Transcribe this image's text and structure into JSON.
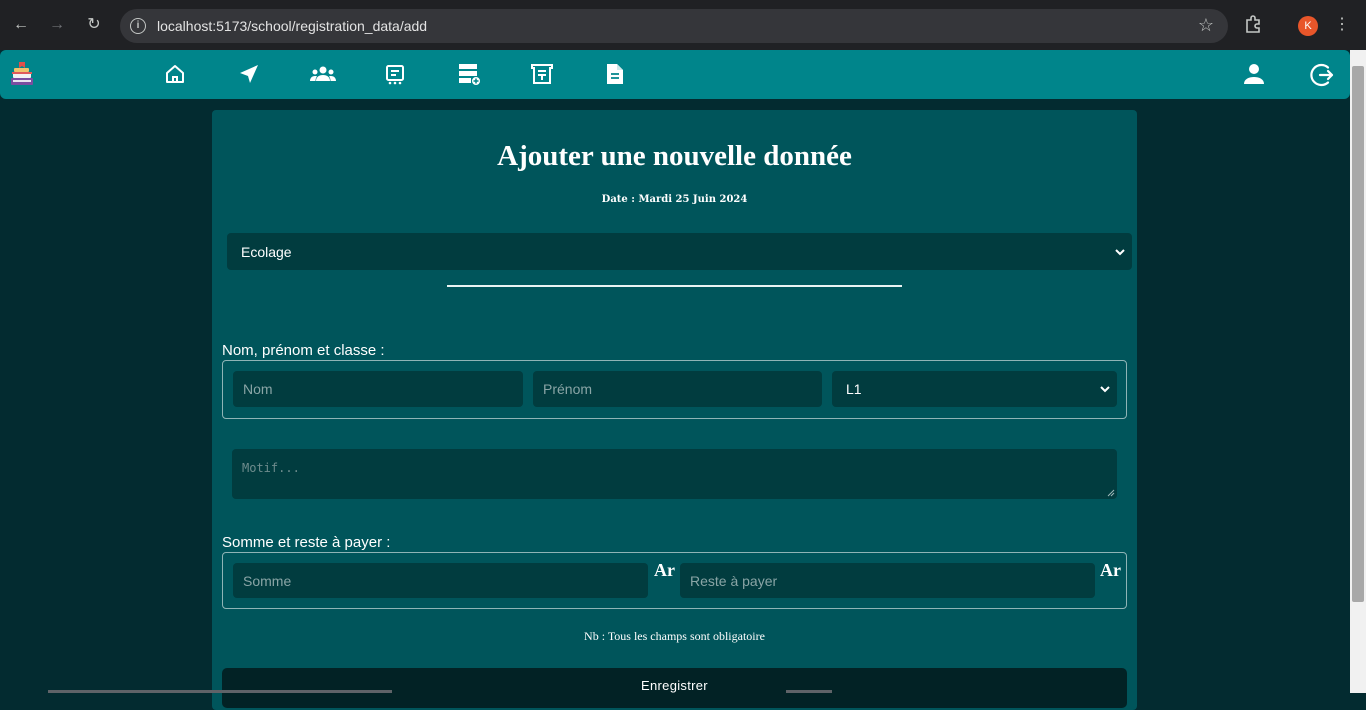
{
  "browser": {
    "url": "localhost:5173/school/registration_data/add",
    "profile_initial": "K"
  },
  "navbar": {
    "icons": [
      "home-icon",
      "send-icon",
      "group-icon",
      "calendar-list-icon",
      "storage-add-icon",
      "receipt-icon",
      "document-icon",
      "account-icon",
      "logout-icon"
    ]
  },
  "form": {
    "title": "Ajouter une nouvelle donnée",
    "date": "Date : Mardi 25 Juin 2024",
    "type_select": "Ecolage",
    "identity_label": "Nom, prénom et classe :",
    "nom_placeholder": "Nom",
    "prenom_placeholder": "Prénom",
    "classe_select": "L1",
    "motif_placeholder": "Motif...",
    "amount_label": "Somme et reste à payer :",
    "somme_placeholder": "Somme",
    "reste_placeholder": "Reste à payer",
    "currency": "Ar",
    "note": "Nb : Tous les champs sont obligatoire",
    "submit_label": "Enregistrer"
  },
  "colors": {
    "page_bg": "#032b30",
    "navbar_bg": "#00858b",
    "card_bg": "#00555b",
    "input_bg": "#013c3f",
    "submit_bg": "#022225"
  }
}
